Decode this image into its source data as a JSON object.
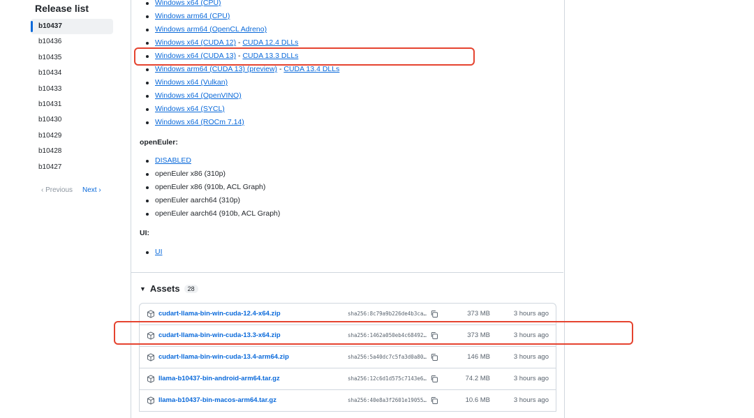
{
  "sidebar": {
    "title": "Release list",
    "releases": [
      "b10437",
      "b10436",
      "b10435",
      "b10434",
      "b10433",
      "b10431",
      "b10430",
      "b10429",
      "b10428",
      "b10427"
    ],
    "active": "b10437",
    "prev_label": "‹  Previous",
    "next_label": "Next  ›"
  },
  "windows_links": [
    {
      "label": "Windows x64 (CPU)"
    },
    {
      "label": "Windows arm64 (CPU)"
    },
    {
      "label": "Windows arm64 (OpenCL Adreno)"
    },
    {
      "label": "Windows x64 (CUDA 12)",
      "sep": " - ",
      "extra": "CUDA 12.4 DLLs"
    },
    {
      "label": "Windows x64 (CUDA 13)",
      "sep": " - ",
      "extra": "CUDA 13.3 DLLs"
    },
    {
      "label": "Windows arm64 (CUDA 13) (preview)",
      "sep": " - ",
      "extra": "CUDA 13.4 DLLs"
    },
    {
      "label": "Windows x64 (Vulkan)"
    },
    {
      "label": "Windows x64 (OpenVINO)"
    },
    {
      "label": "Windows x64 (SYCL)"
    },
    {
      "label": "Windows x64 (ROCm 7.14)"
    }
  ],
  "openeuler": {
    "heading": "openEuler:",
    "link": "DISABLED",
    "items": [
      "openEuler x86 (310p)",
      "openEuler x86 (910b, ACL Graph)",
      "openEuler aarch64 (310p)",
      "openEuler aarch64 (910b, ACL Graph)"
    ]
  },
  "ui_section": {
    "heading": "UI:",
    "link": "UI"
  },
  "assets": {
    "title": "Assets",
    "count": "28",
    "rows": [
      {
        "name": "cudart-llama-bin-win-cuda-12.4-x64.zip",
        "hash": "sha256:8c79a9b226de4b3ca…",
        "size": "373 MB",
        "time": "3 hours ago"
      },
      {
        "name": "cudart-llama-bin-win-cuda-13.3-x64.zip",
        "hash": "sha256:1462a050eb4c68492…",
        "size": "373 MB",
        "time": "3 hours ago"
      },
      {
        "name": "cudart-llama-bin-win-cuda-13.4-arm64.zip",
        "hash": "sha256:5a40dc7c5fa3d0a80…",
        "size": "146 MB",
        "time": "3 hours ago"
      },
      {
        "name": "llama-b10437-bin-android-arm64.tar.gz",
        "hash": "sha256:12c6d1d575c7143e6…",
        "size": "74.2 MB",
        "time": "3 hours ago"
      },
      {
        "name": "llama-b10437-bin-macos-arm64.tar.gz",
        "hash": "sha256:40e8a3f2601e19055…",
        "size": "10.6 MB",
        "time": "3 hours ago"
      }
    ]
  },
  "colors": {
    "link": "#0969da",
    "highlight": "#e5432f",
    "border": "#d0d7de"
  },
  "icons": {
    "asset": "package-icon",
    "copy": "copy-icon",
    "collapse": "triangle-down-icon"
  }
}
